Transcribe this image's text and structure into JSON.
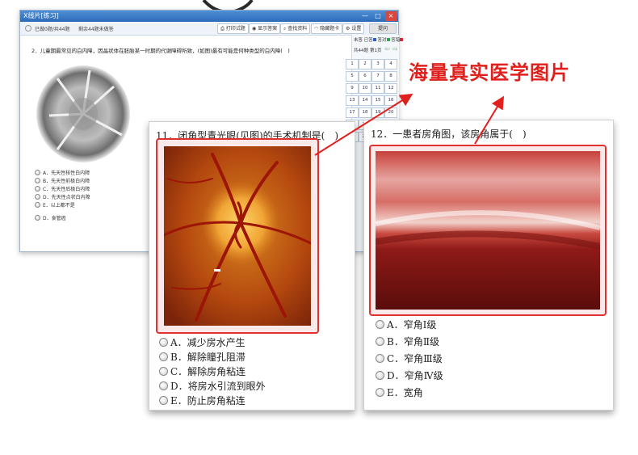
{
  "window": {
    "title": "X线片[练习]",
    "controls": [
      "—",
      "□",
      "×"
    ],
    "status_answered": "已做0题/共44题",
    "status_remaining": "剩余44题未做答",
    "toolbar": {
      "print": "打印试题",
      "show_answer": "显示答案",
      "search": "查找资料",
      "hide_card": "隐藏题卡",
      "settings": "设置",
      "submit": "提问"
    },
    "legend": {
      "not_done": "未答",
      "done": "已答",
      "correct": "答对",
      "wrong": "答错"
    },
    "grid_header": {
      "total": "共44题",
      "page": "第1页"
    },
    "grid_numbers": [
      "1",
      "2",
      "3",
      "4",
      "5",
      "6",
      "7",
      "8",
      "9",
      "10",
      "11",
      "12",
      "13",
      "14",
      "15",
      "16",
      "17",
      "18",
      "19",
      "20",
      "21",
      "22",
      "23",
      "24",
      "25",
      "26",
      "27",
      "28"
    ],
    "question": "2．儿童期最常见的白内障，因晶状体在胚胎某一时期的代谢障碍所致，(如图)最有可能是何种类型的白内障(　)",
    "options": [
      "A．先天性核性白内障",
      "B．先天性前极白内障",
      "C．先天性后极白内障",
      "D．先天性点状白内障",
      "E．以上都不是",
      "D．食管癌"
    ]
  },
  "card_left": {
    "question": "11．闭角型青光眼(见图)的手术机制是(　)",
    "options": [
      "A．减少房水产生",
      "B．解除瞳孔阻滞",
      "C．解除房角粘连",
      "D．将房水引流到眼外",
      "E．防止房角粘连"
    ]
  },
  "card_right": {
    "question": "12．一患者房角图，该房角属于(　)",
    "options": [
      "A．窄角Ⅰ级",
      "B．窄角Ⅱ级",
      "C．窄角Ⅲ级",
      "D．窄角Ⅳ级",
      "E．宽角"
    ]
  },
  "headline": "海量真实医学图片",
  "colors": {
    "accent_red": "#e0201c",
    "titlebar_blue": "#2c6bb8"
  },
  "icons": [
    "print-icon",
    "answer-icon",
    "search-icon",
    "hide-icon",
    "gear-icon",
    "arrow-left-icon",
    "arrow-right-icon"
  ]
}
